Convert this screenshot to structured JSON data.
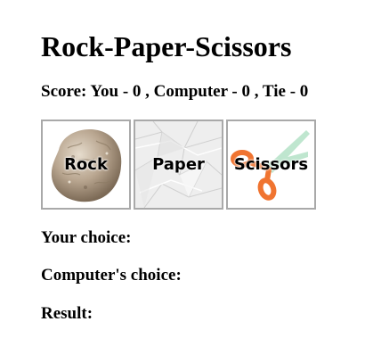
{
  "title": "Rock-Paper-Scissors",
  "score": {
    "text": "Score: You - 0 , Computer - 0 , Tie - 0"
  },
  "choices": [
    {
      "label": "Rock",
      "icon": "rock-icon"
    },
    {
      "label": "Paper",
      "icon": "paper-icon"
    },
    {
      "label": "Scissors",
      "icon": "scissors-icon"
    }
  ],
  "info": {
    "your_choice_label": "Your choice:",
    "your_choice_value": "",
    "computer_choice_label": "Computer's choice:",
    "computer_choice_value": "",
    "result_label": "Result:",
    "result_value": ""
  },
  "colors": {
    "button_border": "#a9a9a9",
    "scissors_handle": "#f07430",
    "scissors_blade": "#bfe6cf"
  }
}
